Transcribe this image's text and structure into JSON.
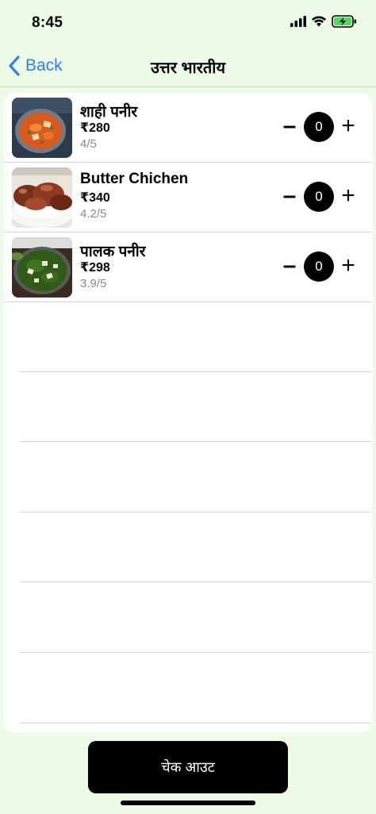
{
  "status_bar": {
    "time": "8:45",
    "icons": [
      "cellular-signal-icon",
      "wifi-icon",
      "battery-charging-icon"
    ],
    "battery_color": "#4cd964"
  },
  "nav": {
    "back_label": "Back",
    "title": "उत्तर भारतीय",
    "accent_color": "#2f7ff0"
  },
  "items": [
    {
      "name": "शाही पनीर",
      "price": "₹280",
      "rating": "4/5",
      "quantity": "0",
      "minus": "–",
      "plus": "+",
      "image": "shahi-paneer-dish-image"
    },
    {
      "name": "Butter Chichen",
      "price": "₹340",
      "rating": "4.2/5",
      "quantity": "0",
      "minus": "–",
      "plus": "+",
      "image": "butter-chicken-dish-image"
    },
    {
      "name": "पालक पनीर",
      "price": "₹298",
      "rating": "3.9/5",
      "quantity": "0",
      "minus": "–",
      "plus": "+",
      "image": "palak-paneer-dish-image"
    }
  ],
  "checkout": {
    "label": "चेक आउट"
  },
  "colors": {
    "background": "#eefbe6",
    "card": "#ffffff",
    "button": "#000000"
  }
}
